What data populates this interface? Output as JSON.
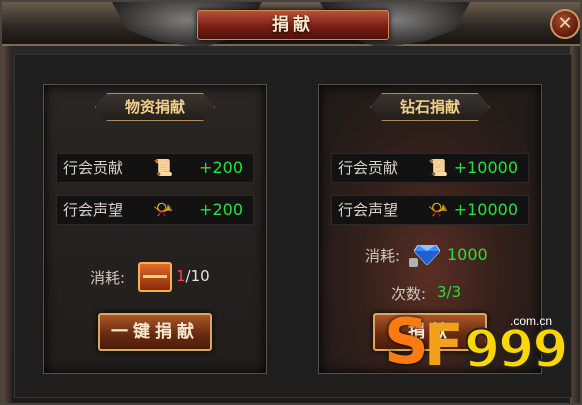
{
  "window": {
    "title": "捐献",
    "close_symbol": "✕"
  },
  "left_panel": {
    "heading": "物资捐献",
    "rows": [
      {
        "label": "行会贡献",
        "icon": "scroll-icon",
        "value": "+200"
      },
      {
        "label": "行会声望",
        "icon": "horn-icon",
        "value": "+200"
      }
    ],
    "cost_label": "消耗:",
    "cost_icon": "chest-icon",
    "cost_have": "1",
    "cost_need": "/10",
    "button_label": "一键捐献"
  },
  "right_panel": {
    "heading": "钻石捐献",
    "rows": [
      {
        "label": "行会贡献",
        "icon": "scroll-icon",
        "value": "+10000"
      },
      {
        "label": "行会声望",
        "icon": "horn-icon",
        "value": "+10000"
      }
    ],
    "cost_label": "消耗:",
    "cost_icon": "diamond-icon",
    "cost_value": "1000",
    "times_label": "次数:",
    "times_value": "3/3",
    "button_label": "捐献"
  },
  "watermark": {
    "brand": "SF999",
    "domain": ".com.cn"
  },
  "colors": {
    "value_green": "#29e03a",
    "accent_gold": "#f0cf8c",
    "title_red": "#7a1f14"
  }
}
